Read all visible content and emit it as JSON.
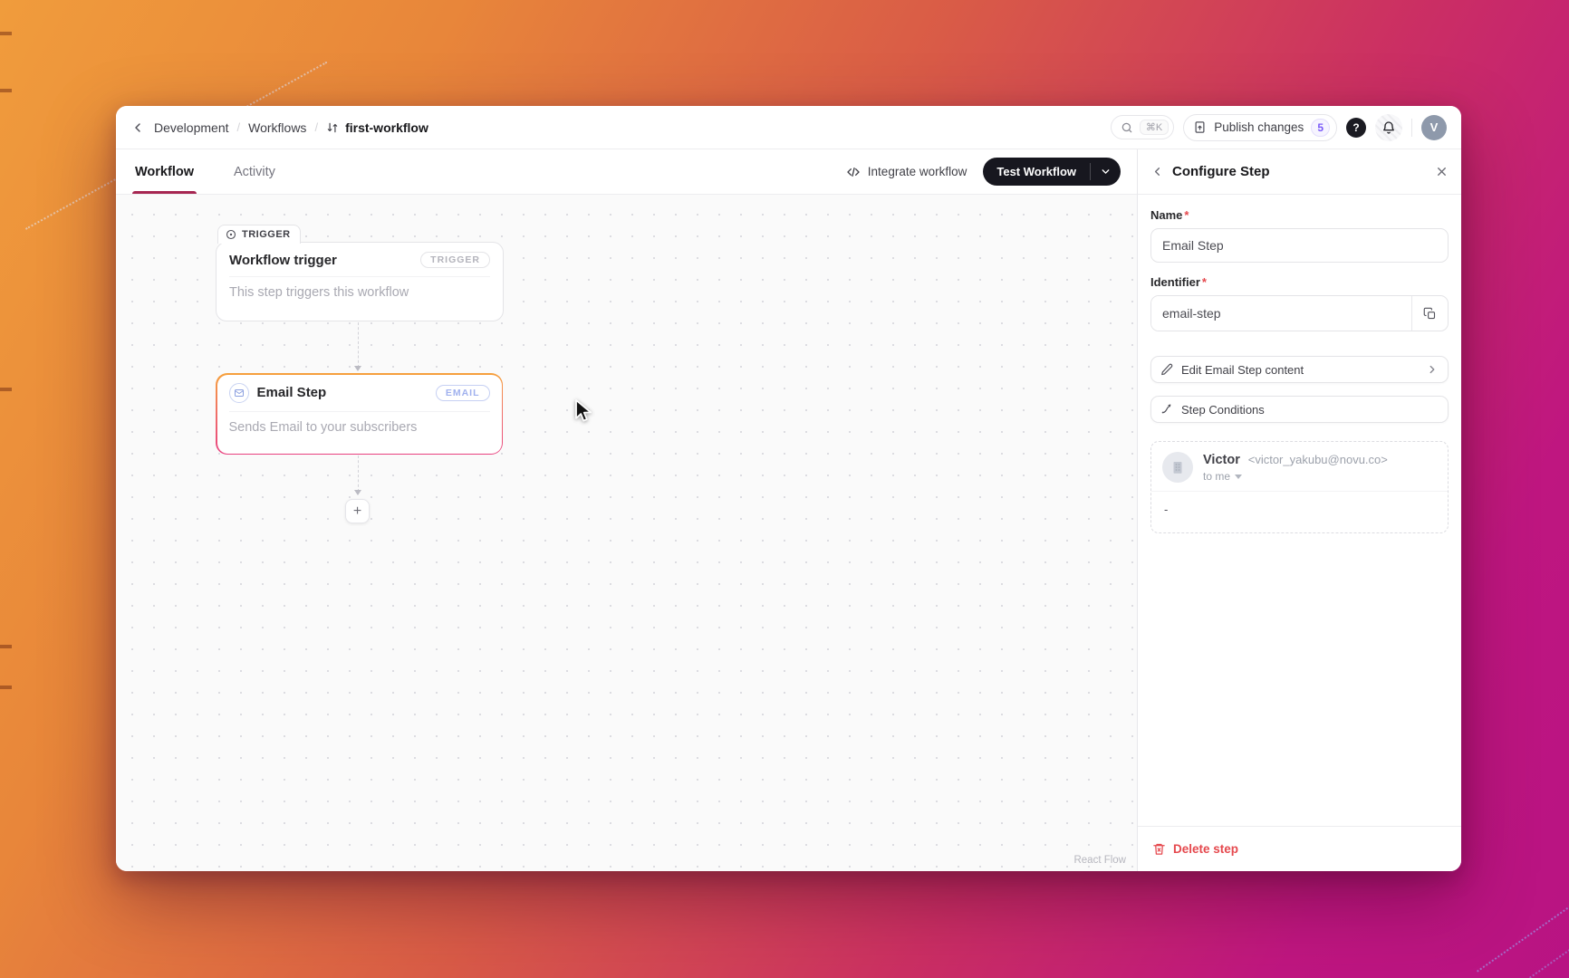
{
  "header": {
    "breadcrumb": [
      "Development",
      "Workflows"
    ],
    "separator": "/",
    "workflow_name": "first-workflow",
    "search_shortcut": "⌘K",
    "publish_label": "Publish changes",
    "publish_badge": "5",
    "help_label": "?",
    "avatar_initial": "V"
  },
  "tabs": {
    "workflow": "Workflow",
    "activity": "Activity"
  },
  "toolbar": {
    "integrate_label": "Integrate workflow",
    "test_label": "Test Workflow"
  },
  "canvas": {
    "trigger_badge": "TRIGGER",
    "trigger_node": {
      "title": "Workflow trigger",
      "tag": "TRIGGER",
      "description": "This step triggers this workflow"
    },
    "email_node": {
      "title": "Email Step",
      "tag": "EMAIL",
      "description": "Sends Email to your subscribers"
    },
    "add_step_label": "+",
    "attribution": "React Flow"
  },
  "panel": {
    "title": "Configure Step",
    "required_mark": "*",
    "name_label": "Name",
    "name_value": "Email Step",
    "identifier_label": "Identifier",
    "identifier_value": "email-step",
    "edit_content_label": "Edit Email Step content",
    "step_conditions_label": "Step Conditions",
    "preview": {
      "sender_name": "Victor",
      "sender_email": "<victor_yakubu@novu.co>",
      "recipient": "to me",
      "body": "-"
    },
    "delete_label": "Delete step"
  },
  "colors": {
    "accent_underline": "#a62651",
    "selected_node_gradient_start": "#f6a13c",
    "selected_node_gradient_end": "#e8417f",
    "badge_purple": "#7a5af8",
    "danger": "#e5484d",
    "dark_button": "#17171f"
  }
}
